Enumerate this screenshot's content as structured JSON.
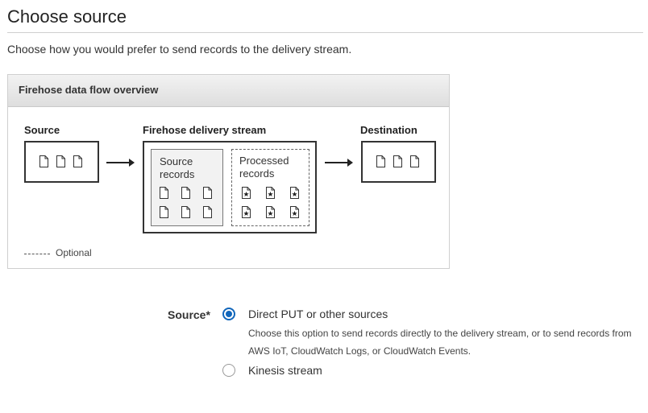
{
  "page": {
    "title": "Choose source",
    "subtitle": "Choose how you would prefer to send records to the delivery stream."
  },
  "overview": {
    "heading": "Firehose data flow overview",
    "source_label": "Source",
    "stream_label": "Firehose delivery stream",
    "destination_label": "Destination",
    "source_records_line1": "Source",
    "source_records_line2": "records",
    "processed_records_line1": "Processed",
    "processed_records_line2": "records",
    "legend_optional": "Optional"
  },
  "source_choice": {
    "label": "Source*",
    "options": [
      {
        "label": "Direct PUT or other sources",
        "description": "Choose this option to send records directly to the delivery stream, or to send records from AWS IoT, CloudWatch Logs, or CloudWatch Events.",
        "selected": true
      },
      {
        "label": "Kinesis stream",
        "selected": false
      }
    ]
  },
  "colors": {
    "accent": "#1166bb",
    "border": "#333333",
    "header_bg": "#e6e6e6"
  }
}
